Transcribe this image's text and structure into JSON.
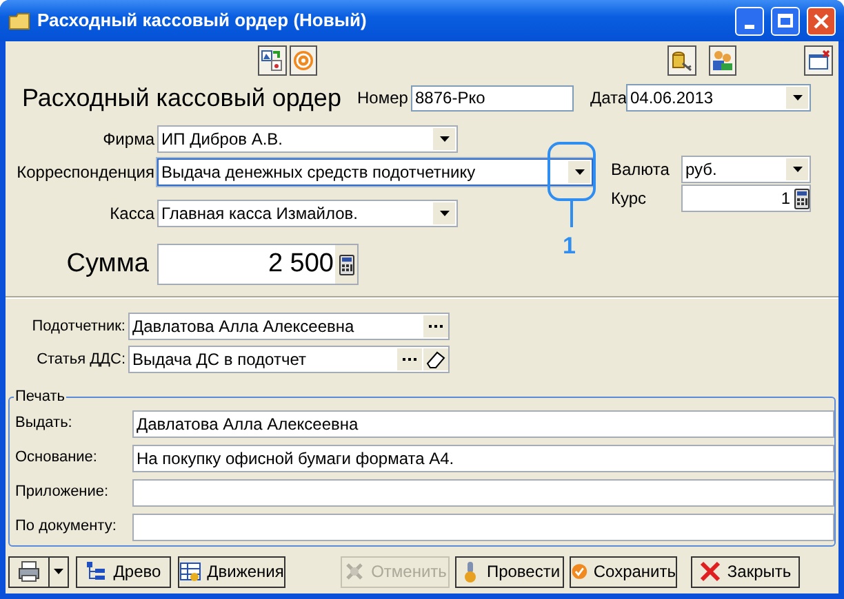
{
  "window": {
    "title": "Расходный кассовый ордер (Новый)"
  },
  "header": {
    "title": "Расходный кассовый ордер",
    "number_label": "Номер",
    "number": "8876-Рко",
    "date_label": "Дата",
    "date": "04.06.2013"
  },
  "fields": [
    {
      "label": "Фирма",
      "value": "ИП Дибров А.В.",
      "focused": false
    },
    {
      "label": "Корреспонденция",
      "value": "Выдача денежных средств подотчетнику",
      "focused": true
    },
    {
      "label": "Касса",
      "value": "Главная касса Измайлов.",
      "focused": false
    }
  ],
  "currency": {
    "label": "Валюта",
    "value": "руб."
  },
  "rate": {
    "label": "Курс",
    "value": "1"
  },
  "sum": {
    "label": "Сумма",
    "value": "2 500"
  },
  "callout": {
    "label": "1"
  },
  "refs": [
    {
      "label": "Подотчетник:",
      "value": "Давлатова Алла Алексеевна",
      "clearable": false
    },
    {
      "label": "Статья ДДС:",
      "value": "Выдача ДС в подотчет",
      "clearable": true
    }
  ],
  "print_group": {
    "title": "Печать",
    "rows": [
      {
        "label": "Выдать:",
        "value": "Давлатова Алла Алексеевна"
      },
      {
        "label": "Основание:",
        "value": "На покупку офисной бумаги формата А4."
      },
      {
        "label": "Приложение:"
      },
      {
        "label": "По документу:"
      }
    ]
  },
  "buttons": [
    {
      "kind": "print",
      "disabled": false
    },
    {
      "kind": "tree",
      "label": "Древо",
      "disabled": false
    },
    {
      "kind": "movements",
      "label": "Движения",
      "disabled": false
    },
    {
      "kind": "cancel",
      "label": "Отменить",
      "disabled": true
    },
    {
      "kind": "post",
      "label": "Провести",
      "disabled": false
    },
    {
      "kind": "save",
      "label": "Сохранить",
      "disabled": false
    },
    {
      "kind": "close",
      "label": "Закрыть",
      "disabled": false
    }
  ]
}
